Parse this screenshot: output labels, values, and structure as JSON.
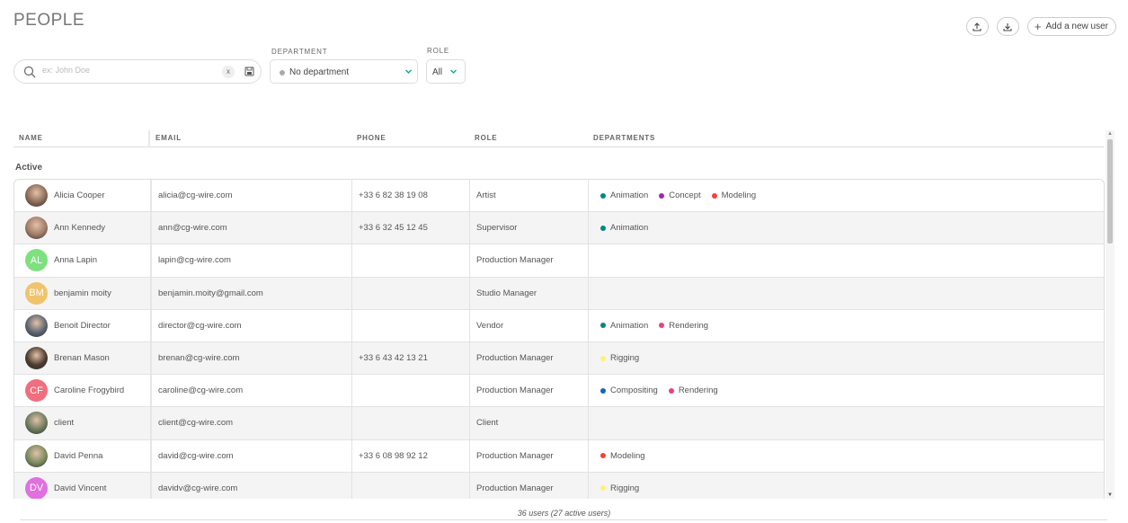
{
  "page": {
    "title": "PEOPLE"
  },
  "actions": {
    "export_icon": "upload-icon",
    "import_icon": "download-icon",
    "add_label": "Add a new user"
  },
  "filters": {
    "search_placeholder": "ex: John Doe",
    "clear_label": "x",
    "department_label": "DEPARTMENT",
    "department_value": "No department",
    "role_label": "ROLE",
    "role_value": "All"
  },
  "table": {
    "columns": {
      "name": "NAME",
      "email": "EMAIL",
      "phone": "PHONE",
      "role": "ROLE",
      "departments": "DEPARTMENTS"
    },
    "group": "Active",
    "rows": [
      {
        "name": "Alicia Cooper",
        "avatar": {
          "type": "photo",
          "initials": "",
          "color": "#8a6a55"
        },
        "email": "alicia@cg-wire.com",
        "phone": "+33 6 82 38 19 08",
        "role": "Artist",
        "departments": [
          {
            "name": "Animation",
            "color": "#00897b"
          },
          {
            "name": "Concept",
            "color": "#9c27b0"
          },
          {
            "name": "Modeling",
            "color": "#f44336"
          }
        ]
      },
      {
        "name": "Ann Kennedy",
        "avatar": {
          "type": "photo",
          "initials": "",
          "color": "#a07a66"
        },
        "email": "ann@cg-wire.com",
        "phone": "+33 6 32 45 12 45",
        "role": "Supervisor",
        "departments": [
          {
            "name": "Animation",
            "color": "#00897b"
          }
        ]
      },
      {
        "name": "Anna Lapin",
        "avatar": {
          "type": "initials",
          "initials": "AL",
          "color": "#7ee07e"
        },
        "email": "lapin@cg-wire.com",
        "phone": "",
        "role": "Production Manager",
        "departments": []
      },
      {
        "name": "benjamin moity",
        "avatar": {
          "type": "initials",
          "initials": "BM",
          "color": "#f0c36d"
        },
        "email": "benjamin.moity@gmail.com",
        "phone": "",
        "role": "Studio Manager",
        "departments": []
      },
      {
        "name": "Benoit Director",
        "avatar": {
          "type": "photo",
          "initials": "",
          "color": "#5b6470"
        },
        "email": "director@cg-wire.com",
        "phone": "",
        "role": "Vendor",
        "departments": [
          {
            "name": "Animation",
            "color": "#00897b"
          },
          {
            "name": "Rendering",
            "color": "#ec407a"
          }
        ]
      },
      {
        "name": "Brenan Mason",
        "avatar": {
          "type": "photo",
          "initials": "",
          "color": "#4a3a2e"
        },
        "email": "brenan@cg-wire.com",
        "phone": "+33 6 43 42 13 21",
        "role": "Production Manager",
        "departments": [
          {
            "name": "Rigging",
            "color": "#fff176"
          }
        ]
      },
      {
        "name": "Caroline Frogybird",
        "avatar": {
          "type": "initials",
          "initials": "CF",
          "color": "#f06e7e"
        },
        "email": "caroline@cg-wire.com",
        "phone": "",
        "role": "Production Manager",
        "departments": [
          {
            "name": "Compositing",
            "color": "#1565c0"
          },
          {
            "name": "Rendering",
            "color": "#ec407a"
          }
        ]
      },
      {
        "name": "client",
        "avatar": {
          "type": "photo",
          "initials": "",
          "color": "#6b7a5e"
        },
        "email": "client@cg-wire.com",
        "phone": "",
        "role": "Client",
        "departments": []
      },
      {
        "name": "David Penna",
        "avatar": {
          "type": "photo",
          "initials": "",
          "color": "#7a8a5e"
        },
        "email": "david@cg-wire.com",
        "phone": "+33 6 08 98 92 12",
        "role": "Production Manager",
        "departments": [
          {
            "name": "Modeling",
            "color": "#f44336"
          }
        ]
      },
      {
        "name": "David Vincent",
        "avatar": {
          "type": "initials",
          "initials": "DV",
          "color": "#e070e0"
        },
        "email": "davidv@cg-wire.com",
        "phone": "",
        "role": "Production Manager",
        "departments": [
          {
            "name": "Rigging",
            "color": "#fff176"
          }
        ]
      }
    ]
  },
  "footer": {
    "count": "36 users (27 active users)"
  }
}
